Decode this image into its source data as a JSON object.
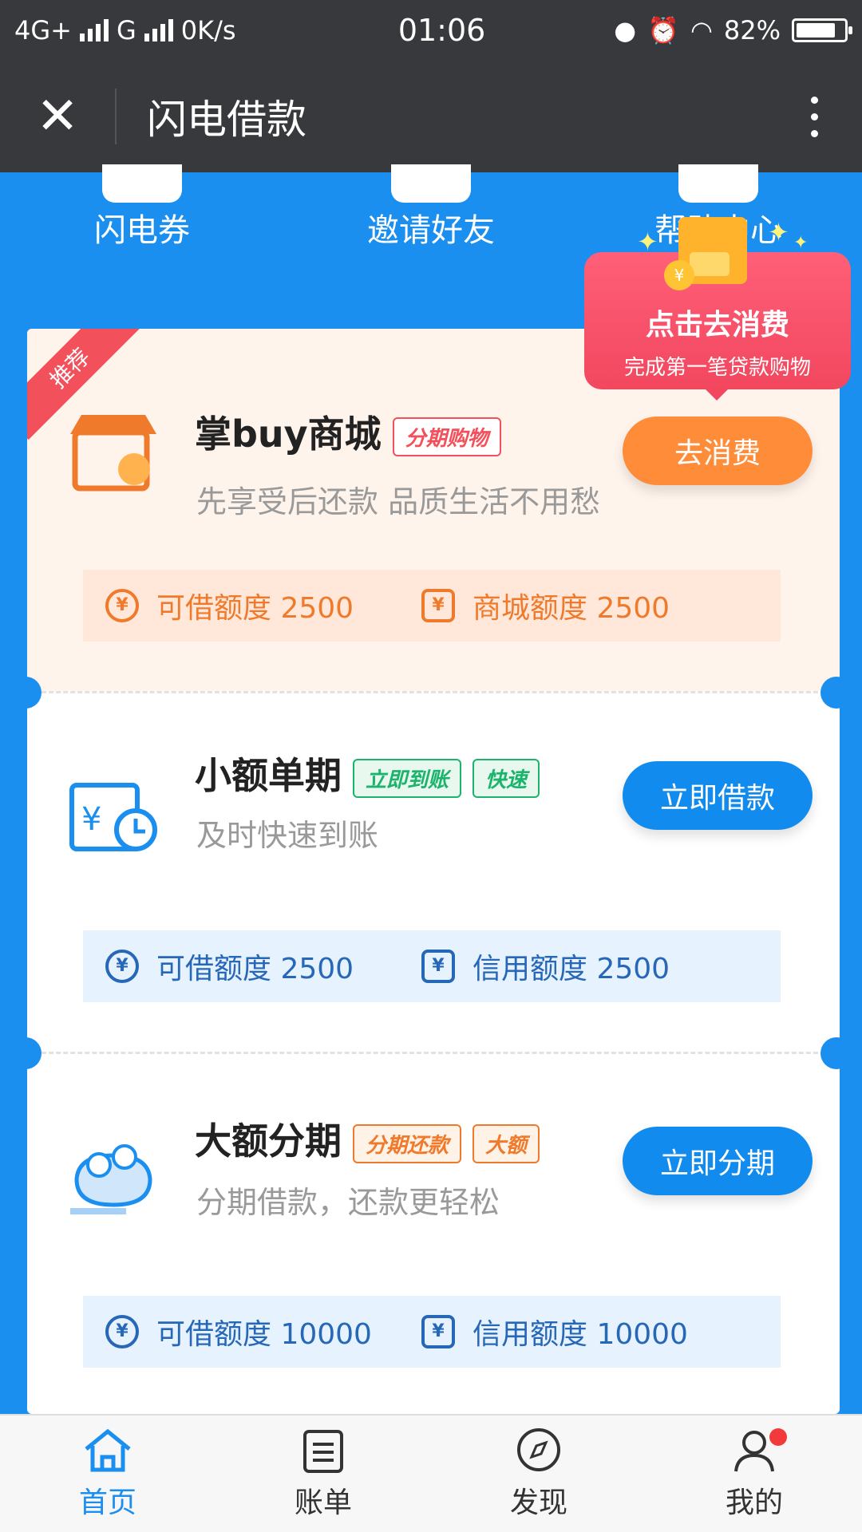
{
  "status_bar": {
    "network1": "4G+",
    "network2": "G",
    "speed": "0K/s",
    "time": "01:06",
    "battery": "82%",
    "battery_level": 0.82
  },
  "nav": {
    "title": "闪电借款"
  },
  "quick_links": [
    {
      "label": "闪电券"
    },
    {
      "label": "邀请好友"
    },
    {
      "label": "帮助中心"
    }
  ],
  "popup": {
    "title": "点击去消费",
    "subtitle": "完成第一笔贷款购物",
    "coin": "¥"
  },
  "cards": [
    {
      "ribbon": "推荐",
      "title": "掌buy商城",
      "tags": [
        "分期购物"
      ],
      "subtitle": "先享受后还款 品质生活不用愁",
      "button": "去消费",
      "quota": [
        {
          "label": "可借额度 2500",
          "icon": "¥"
        },
        {
          "label": "商城额度 2500",
          "icon": "¥"
        }
      ]
    },
    {
      "title": "小额单期",
      "tags": [
        "立即到账",
        "快速"
      ],
      "subtitle": "及时快速到账",
      "button": "立即借款",
      "quota": [
        {
          "label": "可借额度 2500",
          "icon": "¥"
        },
        {
          "label": "信用额度 2500",
          "icon": "¥"
        }
      ]
    },
    {
      "title": "大额分期",
      "tags": [
        "分期还款",
        "大额"
      ],
      "subtitle": "分期借款，还款更轻松",
      "button": "立即分期",
      "quota": [
        {
          "label": "可借额度 10000",
          "icon": "¥"
        },
        {
          "label": "信用额度 10000",
          "icon": "¥"
        }
      ]
    }
  ],
  "tabs": [
    {
      "label": "首页"
    },
    {
      "label": "账单"
    },
    {
      "label": "发现"
    },
    {
      "label": "我的"
    }
  ],
  "colors": {
    "primary_blue": "#1a8ff0",
    "orange": "#ff8c39",
    "red": "#f2505b",
    "green": "#1cb36c"
  }
}
